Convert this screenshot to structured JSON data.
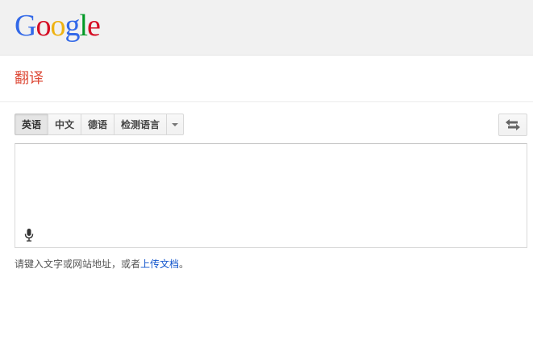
{
  "header": {
    "logo_text": [
      "G",
      "o",
      "o",
      "g",
      "l",
      "e"
    ],
    "logo_colors": [
      "#3369e8",
      "#d50f25",
      "#eeb211",
      "#3369e8",
      "#009925",
      "#d50f25"
    ]
  },
  "page": {
    "title": "翻译"
  },
  "source_languages": {
    "items": [
      {
        "label": "英语",
        "active": true
      },
      {
        "label": "中文",
        "active": false
      },
      {
        "label": "德语",
        "active": false
      },
      {
        "label": "检测语言",
        "active": false
      }
    ],
    "dropdown_icon": "chevron-down-icon"
  },
  "swap": {
    "icon": "swap-arrows-icon"
  },
  "source_text": {
    "value": "",
    "mic_icon": "microphone-icon"
  },
  "hint": {
    "prefix": "请键入文字或网站地址，或者",
    "link": "上传文档",
    "suffix": "。"
  },
  "colors": {
    "title_red": "#dd4b39",
    "link_blue": "#15c"
  }
}
